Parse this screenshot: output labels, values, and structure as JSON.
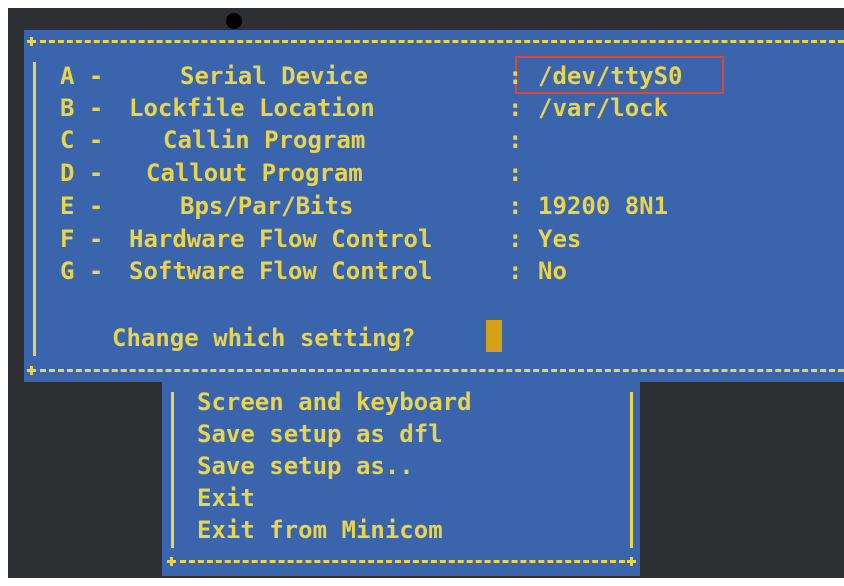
{
  "settings": [
    {
      "letter": "A -",
      "label": "Serial Device",
      "value": "/dev/ttyS0"
    },
    {
      "letter": "B -",
      "label": "Lockfile Location",
      "value": "/var/lock"
    },
    {
      "letter": "C -",
      "label": "Callin Program",
      "value": ""
    },
    {
      "letter": "D -",
      "label": "Callout Program",
      "value": ""
    },
    {
      "letter": "E -",
      "label": "Bps/Par/Bits",
      "value": "19200 8N1"
    },
    {
      "letter": "F -",
      "label": "Hardware Flow Control",
      "value": "Yes"
    },
    {
      "letter": "G -",
      "label": "Software Flow Control",
      "value": "No"
    }
  ],
  "separator": ":",
  "prompt": "Change which setting?",
  "menu": [
    "Screen and keyboard",
    "Save setup as dfl",
    "Save setup as..",
    "Exit",
    "Exit from Minicom"
  ],
  "colors": {
    "panel_bg": "#3a65ad",
    "text": "#e8d44d",
    "terminal_bg": "#2d2f33",
    "highlight_border": "#d9483b",
    "cursor": "#d4a017"
  }
}
